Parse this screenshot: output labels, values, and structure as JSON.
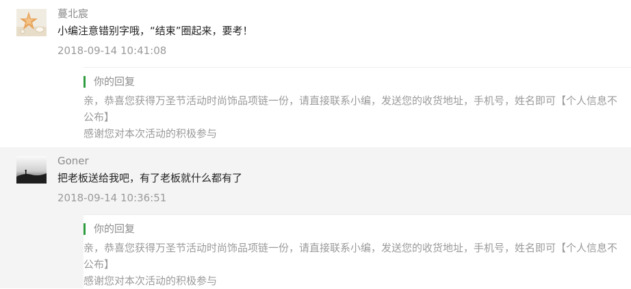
{
  "comments": [
    {
      "nickname": "蔓北宸",
      "avatar_icon": "starfish-shell-avatar",
      "text": "小编注意错别字哦，“结束”圈起来，要考！",
      "time": "2018-09-14 10:41:08",
      "reply": {
        "label": "你的回复",
        "body": "亲，恭喜您获得万圣节活动时尚饰品项链一份，请直接联系小编，发送您的收货地址，手机号，姓名即可【个人信息不公布】",
        "thanks": "感谢您对本次活动的积极参与"
      }
    },
    {
      "nickname": "Goner",
      "avatar_icon": "misty-landscape-avatar",
      "text": "把老板送给我吧，有了老板就什么都有了",
      "time": "2018-09-14 10:36:51",
      "reply": {
        "label": "你的回复",
        "body": "亲，恭喜您获得万圣节活动时尚饰品项链一份，请直接联系小编，发送您的收货地址，手机号，姓名即可【个人信息不公布】",
        "thanks": "感谢您对本次活动的积极参与"
      }
    }
  ],
  "colors": {
    "reply_bar": "#2e9c3f",
    "highlight_bg": "#f4f4f4",
    "text": "#222222",
    "muted": "#9a9a9a"
  }
}
